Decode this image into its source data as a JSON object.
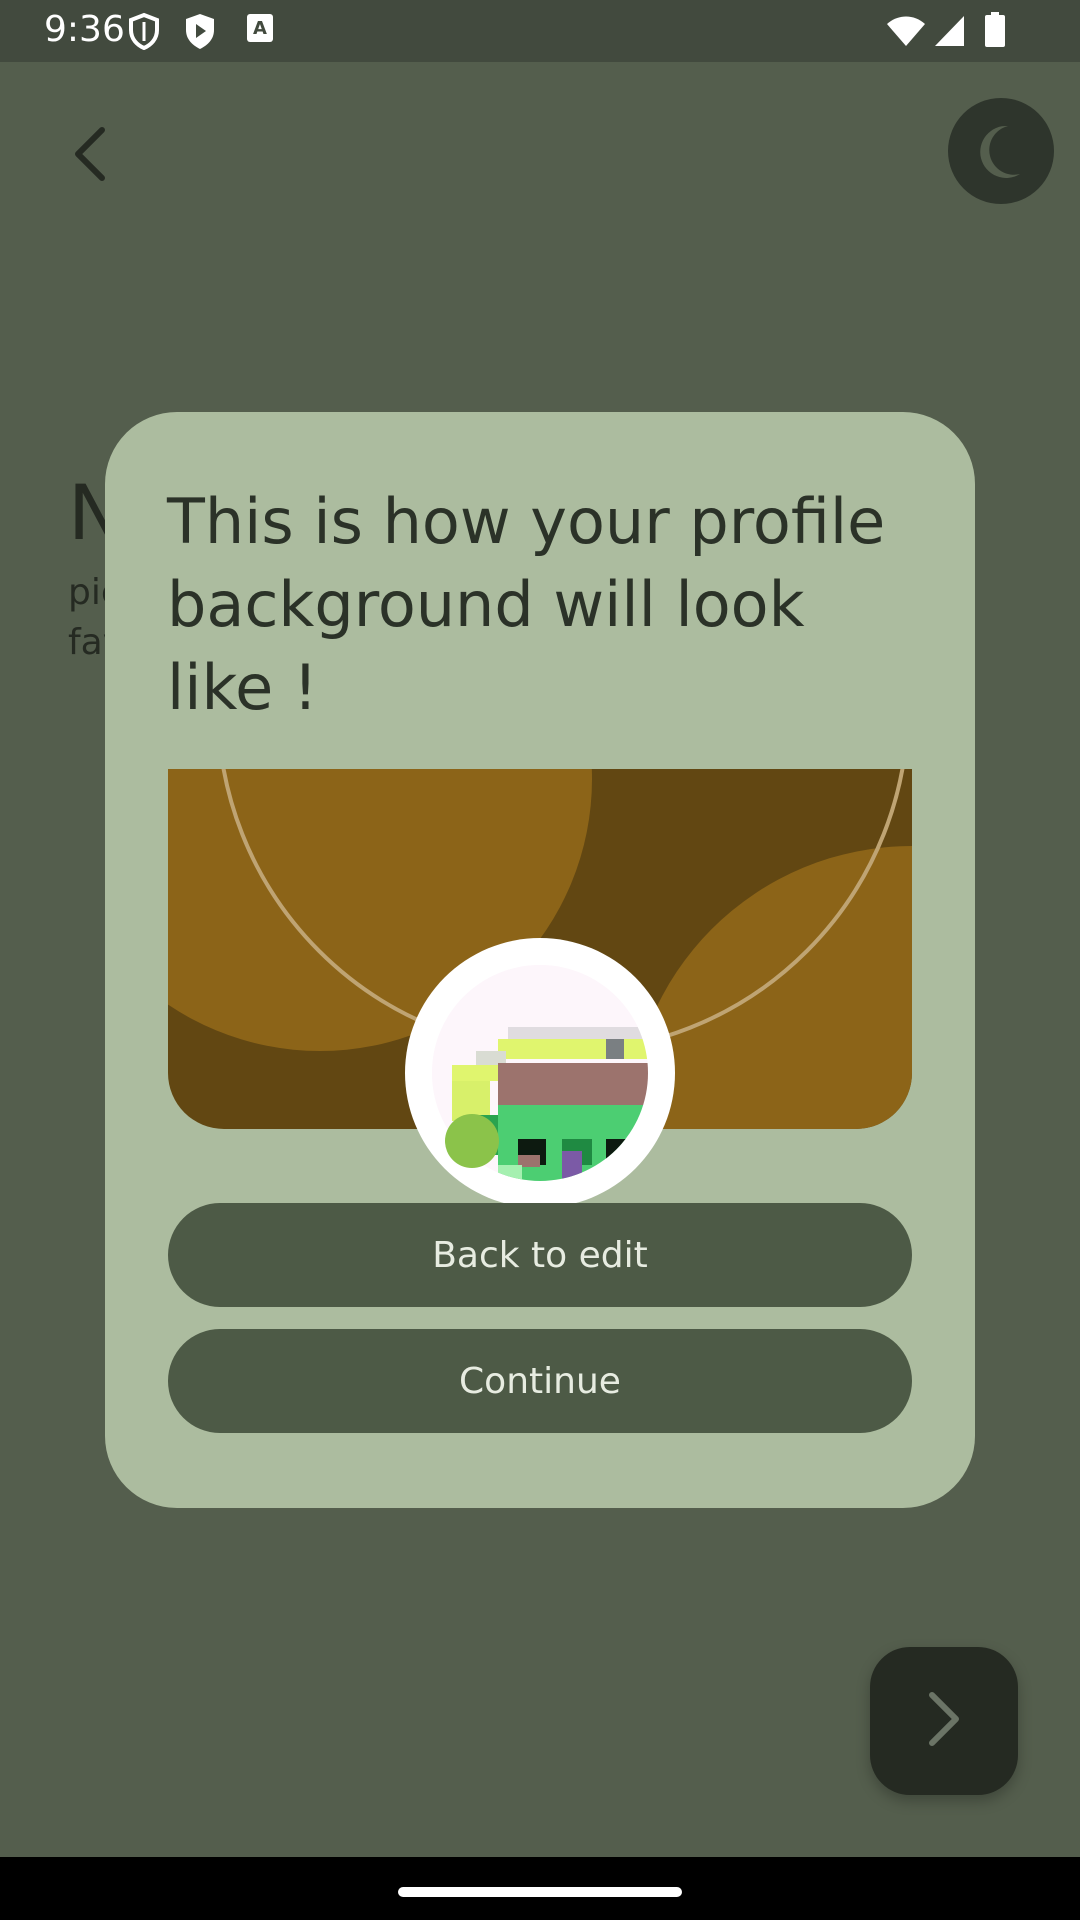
{
  "status_bar": {
    "time": "9:36",
    "left_icons": [
      "shield-outline-icon",
      "shield-play-icon",
      "keyboard-a-icon"
    ],
    "right_icons": [
      "wifi-icon",
      "signal-icon",
      "battery-icon"
    ]
  },
  "background_screen": {
    "back_icon": "chevron-left-icon",
    "theme_icon": "moon-icon",
    "heading_partial": "N",
    "body_partial_lines": [
      "pic",
      "fav"
    ],
    "next_icon": "chevron-right-icon"
  },
  "dialog": {
    "title": "This is how your profile background will look like !",
    "back_button_label": "Back to edit",
    "continue_button_label": "Continue"
  },
  "colors": {
    "scrim_background": "#545e4d",
    "dialog_surface": "#acbc9f",
    "button_fill": "#4d5a46",
    "banner_dark": "#624712",
    "banner_light": "#8c6418",
    "online_indicator": "#8bc34a"
  }
}
